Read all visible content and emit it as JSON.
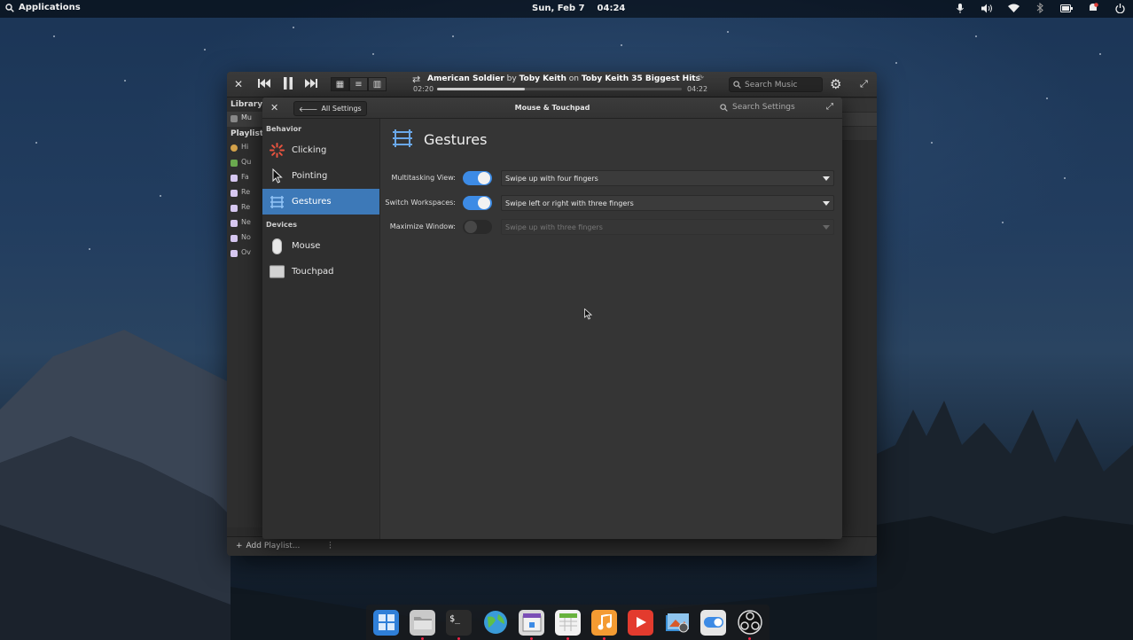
{
  "top_panel": {
    "applications_label": "Applications",
    "date": "Sun, Feb 7",
    "time": "04:24",
    "indicators": [
      "microphone-icon",
      "volume-icon",
      "wifi-icon",
      "bluetooth-icon",
      "battery-icon",
      "notifications-icon",
      "power-icon"
    ]
  },
  "music": {
    "track_title": "American Soldier",
    "by_word": "by",
    "artist": "Toby Keith",
    "on_word": "on",
    "album": "Toby Keith 35 Biggest Hits",
    "elapsed": "02:20",
    "remaining": "04:22",
    "progress": 0.36,
    "search_placeholder": "Search Music",
    "sidebar": {
      "library_label": "Library",
      "library_items": [
        "Mu"
      ],
      "playlists_label": "Playlists",
      "playlist_items": [
        "Hi",
        "Qu",
        "Fa",
        "Re",
        "Re",
        "Ne",
        "No",
        "Ov"
      ]
    },
    "add_playlist_label": "Add Playlist..."
  },
  "settings": {
    "back_label": "All Settings",
    "title": "Mouse & Touchpad",
    "search_placeholder": "Search Settings",
    "sidebar": {
      "behavior_label": "Behavior",
      "behavior_items": [
        "Clicking",
        "Pointing",
        "Gestures"
      ],
      "devices_label": "Devices",
      "device_items": [
        "Mouse",
        "Touchpad"
      ]
    },
    "page_title": "Gestures",
    "rows": [
      {
        "label": "Multitasking View:",
        "enabled": true,
        "value": "Swipe up with four fingers"
      },
      {
        "label": "Switch Workspaces:",
        "enabled": true,
        "value": "Swipe left or right with three fingers"
      },
      {
        "label": "Maximize Window:",
        "enabled": false,
        "value": "Swipe up with three fingers"
      }
    ]
  },
  "dock": {
    "apps": [
      "multitasking-icon",
      "files-icon",
      "terminal-icon",
      "web-browser-icon",
      "appcenter-icon",
      "calendar-icon",
      "music-icon",
      "videos-icon",
      "photos-icon",
      "system-settings-icon",
      "obs-icon"
    ]
  }
}
